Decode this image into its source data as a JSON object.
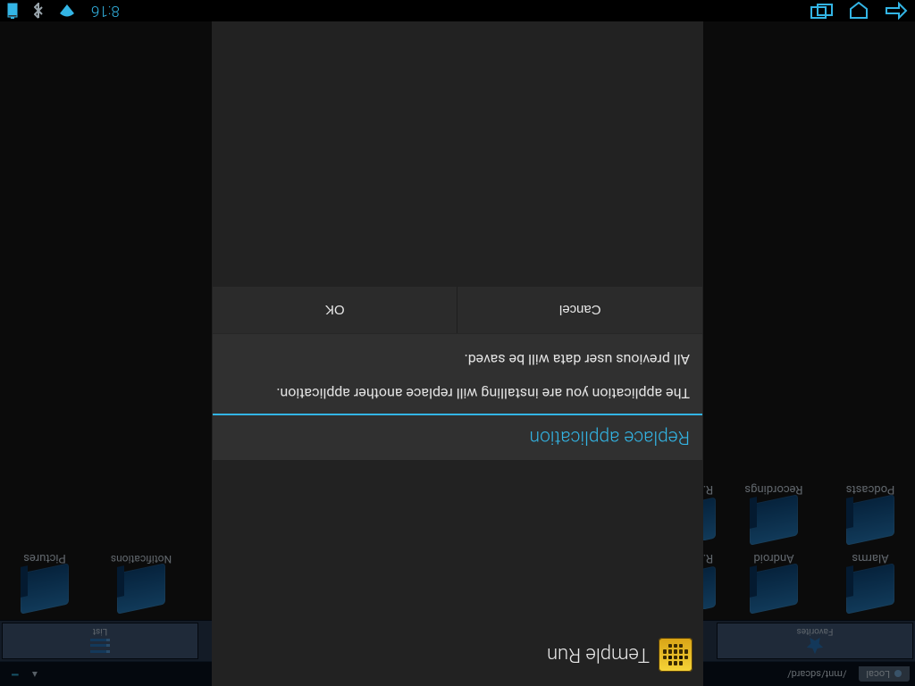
{
  "statusbar": {
    "clock": "8:16"
  },
  "fileman": {
    "location_label": "Local",
    "path": "/mnt/sdcard/",
    "panel_left_label": "Favorites",
    "panel_right_label": "List",
    "folders_row1": [
      {
        "label": "Alarms"
      },
      {
        "label": "Android"
      },
      {
        "label": "R..."
      }
    ],
    "folders_row1_right": [
      {
        "label": "Notifications"
      },
      {
        "label": "Pictures"
      }
    ],
    "folders_row2": [
      {
        "label": "Podcasts"
      },
      {
        "label": "Recordings"
      },
      {
        "label": "R..."
      }
    ]
  },
  "installer": {
    "app_name": "Temple Run"
  },
  "dialog": {
    "title": "Replace application",
    "para1": "The application you are installing will replace another application.",
    "para2": "All previous user data will be saved.",
    "cancel_label": "Cancel",
    "ok_label": "OK"
  }
}
